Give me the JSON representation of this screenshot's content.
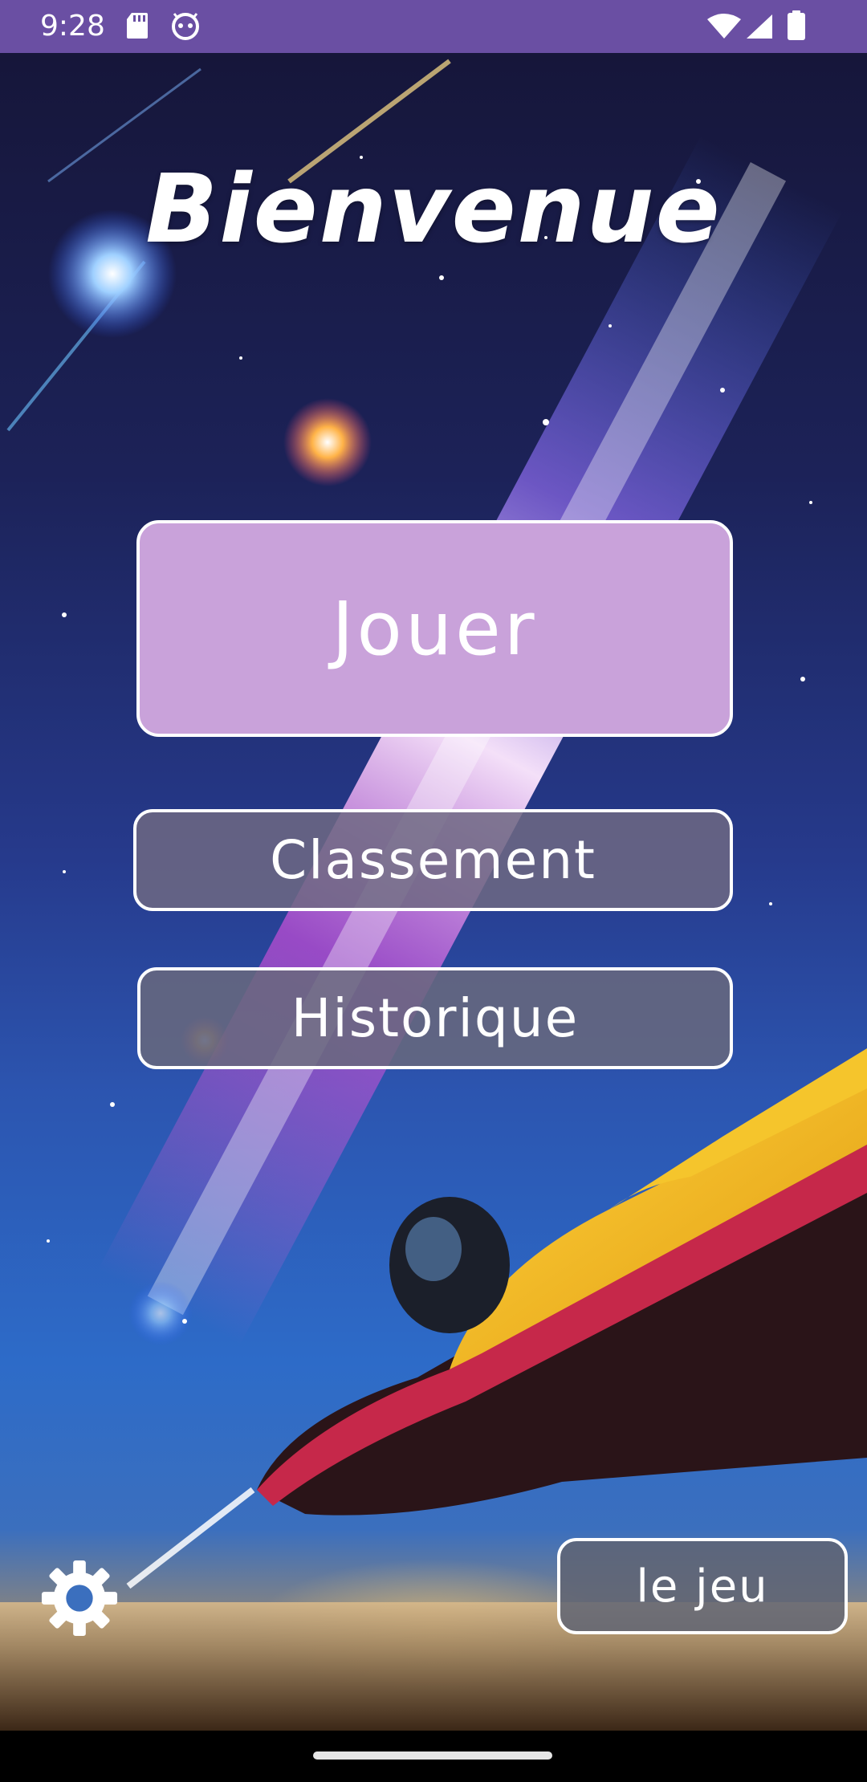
{
  "status_bar": {
    "time": "9:28",
    "icons": [
      "sd-card-icon",
      "android-debug-icon",
      "wifi-icon",
      "signal-icon",
      "battery-icon"
    ],
    "color": "#6a4fa3"
  },
  "main": {
    "title": "Bienvenue",
    "play_label": "Jouer",
    "ranking_label": "Classement",
    "history_label": "Historique",
    "about_label": "le jeu",
    "settings_icon": "gear-icon"
  },
  "colors": {
    "play_button": "#c9a2da",
    "secondary_button": "#6b6b80",
    "border": "#ffffff"
  }
}
